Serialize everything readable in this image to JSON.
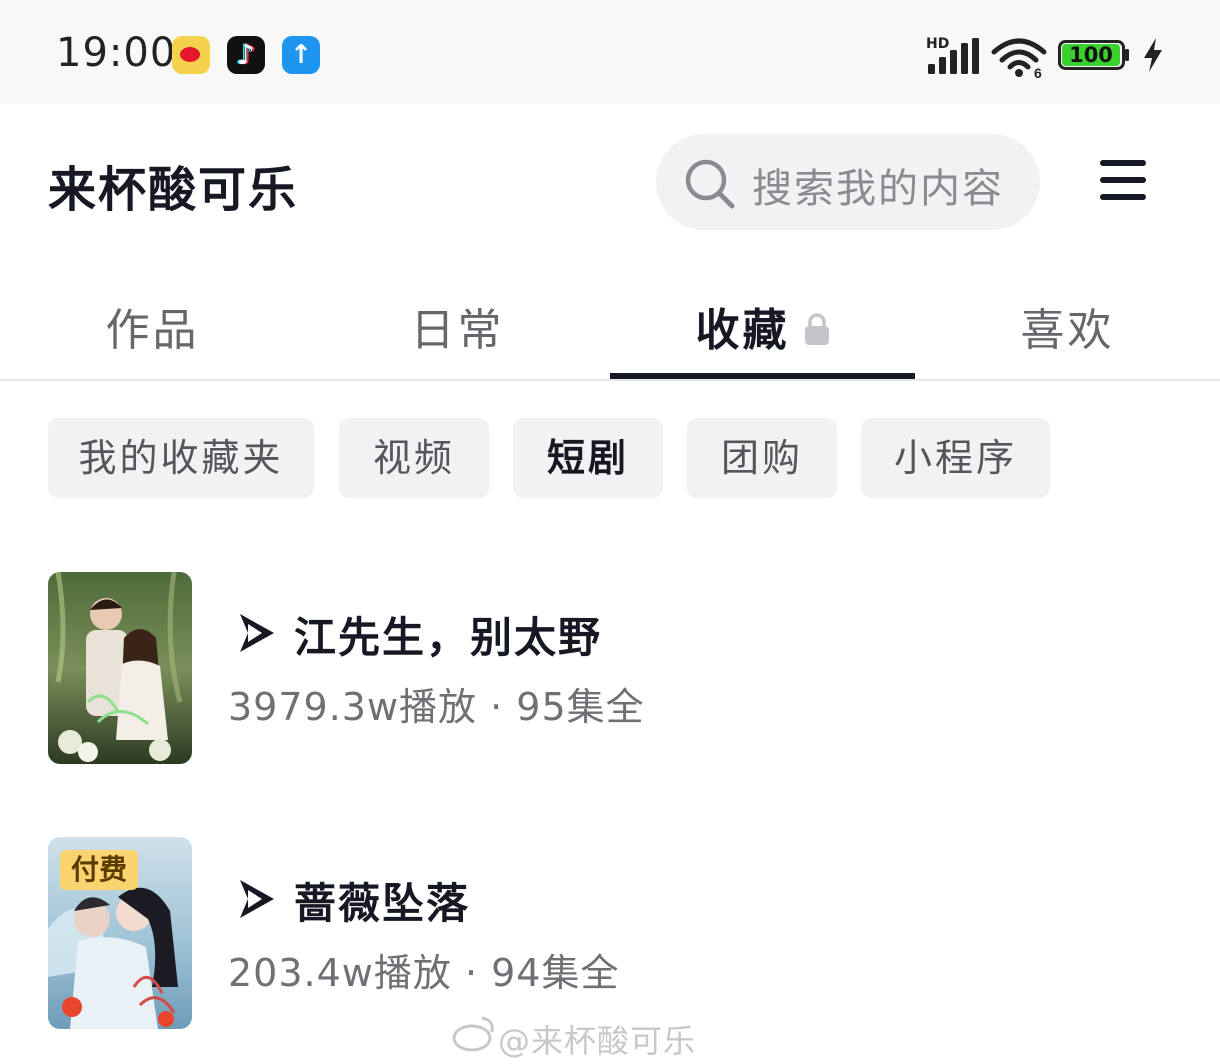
{
  "status_bar": {
    "time": "19:00",
    "network": "HD",
    "battery": "100",
    "apps": [
      "weibo-icon",
      "douyin-icon",
      "upload-icon"
    ]
  },
  "header": {
    "username": "来杯酸可乐",
    "search_placeholder": "搜索我的内容"
  },
  "tabs": [
    {
      "label": "作品"
    },
    {
      "label": "日常"
    },
    {
      "label": "收藏"
    },
    {
      "label": "喜欢"
    }
  ],
  "active_tab": "收藏",
  "filter_chips": [
    {
      "label": "我的收藏夹"
    },
    {
      "label": "视频"
    },
    {
      "label": "短剧"
    },
    {
      "label": "团购"
    },
    {
      "label": "小程序"
    }
  ],
  "active_chip": "短剧",
  "items": [
    {
      "title": "江先生，别太野",
      "meta": "3979.3w播放 · 95集全"
    },
    {
      "title": "蔷薇坠落",
      "meta": "203.4w播放 · 94集全",
      "badge": "付费"
    }
  ],
  "watermark": "@来杯酸可乐",
  "colors": {
    "text_primary": "#161823",
    "chip_bg": "#f2f2f4",
    "paid_badge": "#fcd46f",
    "battery_green": "#3ad12e"
  }
}
